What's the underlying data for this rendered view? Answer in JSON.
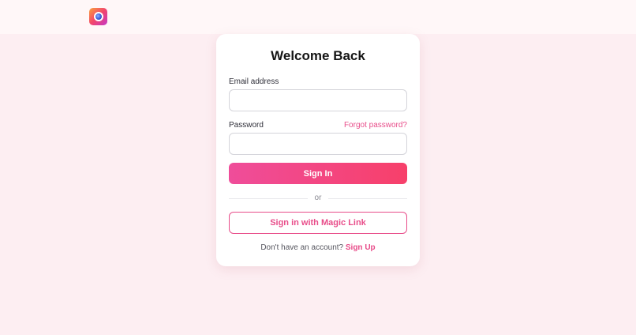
{
  "colors": {
    "accent": "#e84d8a",
    "gradient_start": "#ef4d9a",
    "gradient_end": "#f7406a",
    "background": "#fdeef2"
  },
  "header": {
    "logo_icon": "camera-lens-icon"
  },
  "login": {
    "title": "Welcome Back",
    "email_label": "Email address",
    "email_value": "",
    "email_placeholder": "",
    "password_label": "Password",
    "password_value": "",
    "password_placeholder": "",
    "forgot_link": "Forgot password?",
    "signin_label": "Sign In",
    "divider_text": "or",
    "magic_link_label": "Sign in with Magic Link",
    "signup_prompt": "Don't have an account?",
    "signup_link": "Sign Up"
  }
}
